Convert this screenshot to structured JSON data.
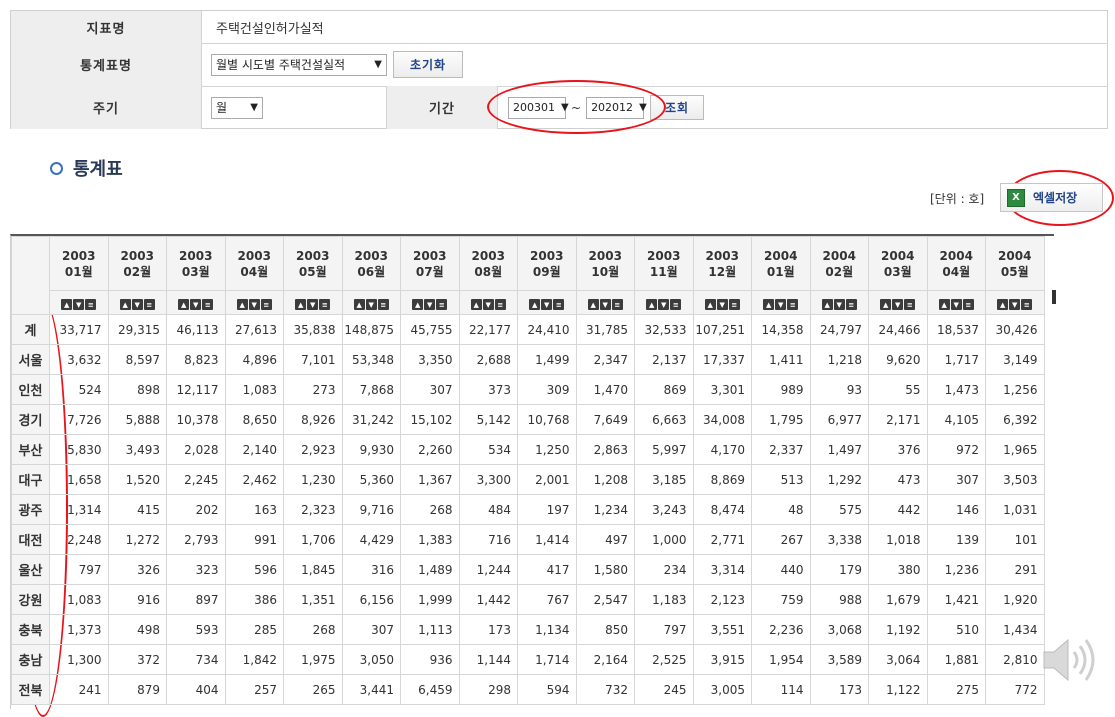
{
  "filter": {
    "indicator_label": "지표명",
    "indicator_value": "주택건설인허가실적",
    "stat_table_label": "통계표명",
    "stat_table_value": "월별 시도별 주택건설실적",
    "reset_button": "초기화",
    "cycle_label": "주기",
    "cycle_value": "월",
    "period_label": "기간",
    "period_start": "200301",
    "period_sep": "~",
    "period_end": "202012",
    "search_button": "조회"
  },
  "section": {
    "title": "통계표",
    "unit": "[단위 : 호]",
    "excel_button": "엑셀저장"
  },
  "table": {
    "columns": [
      {
        "year": "2003",
        "month": "01월"
      },
      {
        "year": "2003",
        "month": "02월"
      },
      {
        "year": "2003",
        "month": "03월"
      },
      {
        "year": "2003",
        "month": "04월"
      },
      {
        "year": "2003",
        "month": "05월"
      },
      {
        "year": "2003",
        "month": "06월"
      },
      {
        "year": "2003",
        "month": "07월"
      },
      {
        "year": "2003",
        "month": "08월"
      },
      {
        "year": "2003",
        "month": "09월"
      },
      {
        "year": "2003",
        "month": "10월"
      },
      {
        "year": "2003",
        "month": "11월"
      },
      {
        "year": "2003",
        "month": "12월"
      },
      {
        "year": "2004",
        "month": "01월"
      },
      {
        "year": "2004",
        "month": "02월"
      },
      {
        "year": "2004",
        "month": "03월"
      },
      {
        "year": "2004",
        "month": "04월"
      },
      {
        "year": "2004",
        "month": "05월"
      }
    ],
    "rows": [
      {
        "region": "계",
        "values": [
          "33,717",
          "29,315",
          "46,113",
          "27,613",
          "35,838",
          "148,875",
          "45,755",
          "22,177",
          "24,410",
          "31,785",
          "32,533",
          "107,251",
          "14,358",
          "24,797",
          "24,466",
          "18,537",
          "30,426"
        ]
      },
      {
        "region": "서울",
        "values": [
          "3,632",
          "8,597",
          "8,823",
          "4,896",
          "7,101",
          "53,348",
          "3,350",
          "2,688",
          "1,499",
          "2,347",
          "2,137",
          "17,337",
          "1,411",
          "1,218",
          "9,620",
          "1,717",
          "3,149"
        ]
      },
      {
        "region": "인천",
        "values": [
          "524",
          "898",
          "12,117",
          "1,083",
          "273",
          "7,868",
          "307",
          "373",
          "309",
          "1,470",
          "869",
          "3,301",
          "989",
          "93",
          "55",
          "1,473",
          "1,256"
        ]
      },
      {
        "region": "경기",
        "values": [
          "7,726",
          "5,888",
          "10,378",
          "8,650",
          "8,926",
          "31,242",
          "15,102",
          "5,142",
          "10,768",
          "7,649",
          "6,663",
          "34,008",
          "1,795",
          "6,977",
          "2,171",
          "4,105",
          "6,392"
        ]
      },
      {
        "region": "부산",
        "values": [
          "5,830",
          "3,493",
          "2,028",
          "2,140",
          "2,923",
          "9,930",
          "2,260",
          "534",
          "1,250",
          "2,863",
          "5,997",
          "4,170",
          "2,337",
          "1,497",
          "376",
          "972",
          "1,965"
        ]
      },
      {
        "region": "대구",
        "values": [
          "1,658",
          "1,520",
          "2,245",
          "2,462",
          "1,230",
          "5,360",
          "1,367",
          "3,300",
          "2,001",
          "1,208",
          "3,185",
          "8,869",
          "513",
          "1,292",
          "473",
          "307",
          "3,503"
        ]
      },
      {
        "region": "광주",
        "values": [
          "1,314",
          "415",
          "202",
          "163",
          "2,323",
          "9,716",
          "268",
          "484",
          "197",
          "1,234",
          "3,243",
          "8,474",
          "48",
          "575",
          "442",
          "146",
          "1,031"
        ]
      },
      {
        "region": "대전",
        "values": [
          "2,248",
          "1,272",
          "2,793",
          "991",
          "1,706",
          "4,429",
          "1,383",
          "716",
          "1,414",
          "497",
          "1,000",
          "2,771",
          "267",
          "3,338",
          "1,018",
          "139",
          "101"
        ]
      },
      {
        "region": "울산",
        "values": [
          "797",
          "326",
          "323",
          "596",
          "1,845",
          "316",
          "1,489",
          "1,244",
          "417",
          "1,580",
          "234",
          "3,314",
          "440",
          "179",
          "380",
          "1,236",
          "291"
        ]
      },
      {
        "region": "강원",
        "values": [
          "1,083",
          "916",
          "897",
          "386",
          "1,351",
          "6,156",
          "1,999",
          "1,442",
          "767",
          "2,547",
          "1,183",
          "2,123",
          "759",
          "988",
          "1,679",
          "1,421",
          "1,920"
        ]
      },
      {
        "region": "충북",
        "values": [
          "1,373",
          "498",
          "593",
          "285",
          "268",
          "307",
          "1,113",
          "173",
          "1,134",
          "850",
          "797",
          "3,551",
          "2,236",
          "3,068",
          "1,192",
          "510",
          "1,434"
        ]
      },
      {
        "region": "충남",
        "values": [
          "1,300",
          "372",
          "734",
          "1,842",
          "1,975",
          "3,050",
          "936",
          "1,144",
          "1,714",
          "2,164",
          "2,525",
          "3,915",
          "1,954",
          "3,589",
          "3,064",
          "1,881",
          "2,810"
        ]
      },
      {
        "region": "전북",
        "values": [
          "241",
          "879",
          "404",
          "257",
          "265",
          "3,441",
          "6,459",
          "298",
          "594",
          "732",
          "245",
          "3,005",
          "114",
          "173",
          "1,122",
          "275",
          "772"
        ]
      }
    ]
  },
  "icons": {
    "sort_up": "sort-asc-icon",
    "sort_down": "sort-desc-icon",
    "sort_menu": "sort-menu-icon",
    "excel": "excel-icon",
    "speaker": "speaker-icon"
  },
  "colors": {
    "highlight_annotation": "#e8141b",
    "label_bg": "#eeeeee",
    "link_text": "#224488"
  }
}
